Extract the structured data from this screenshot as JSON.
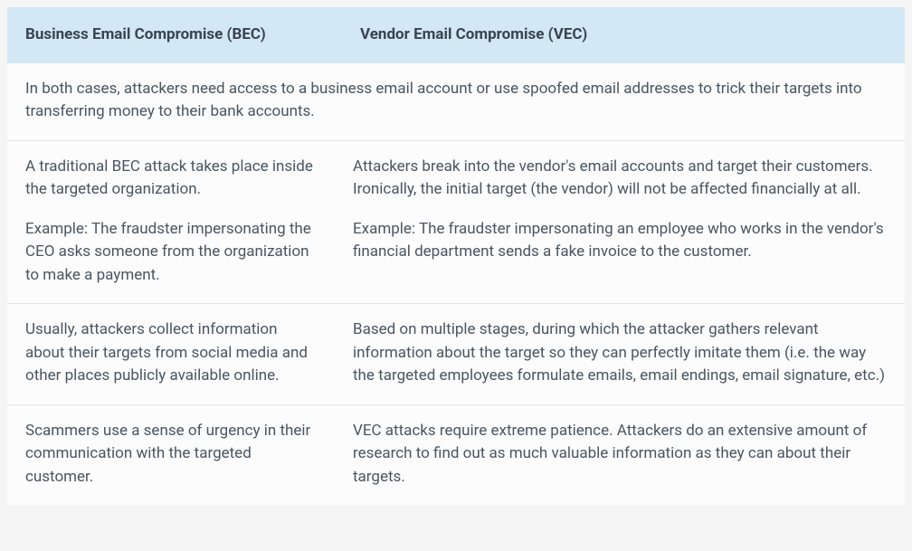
{
  "headers": {
    "bec": "Business Email Compromise (BEC)",
    "vec": "Vendor Email Compromise (VEC)"
  },
  "intro": "In both cases, attackers need access to a business email account or use spoofed email addresses to trick their targets into transferring money to their bank accounts.",
  "rows": [
    {
      "bec": {
        "p1": "A traditional BEC attack takes place inside the targeted organization.",
        "p2": "Example: The fraudster impersonating the CEO asks someone from the organization to make a payment."
      },
      "vec": {
        "p1": "Attackers break into the vendor's email accounts and target their customers. Ironically, the initial target (the vendor) will not be affected financially at all.",
        "p2": "Example: The fraudster impersonating an employee who works in the vendor's financial department sends a fake invoice to the customer."
      }
    },
    {
      "bec": {
        "p1": "Usually, attackers collect information about their targets from social media and other places publicly available online."
      },
      "vec": {
        "p1": "Based on multiple stages, during which the attacker gathers relevant information about the target so they can perfectly imitate them (i.e. the way the targeted employees formulate emails, email endings, email signature, etc.)"
      }
    },
    {
      "bec": {
        "p1": "Scammers use a sense of urgency in their communication with the targeted customer."
      },
      "vec": {
        "p1": "VEC attacks require extreme patience. Attackers do an extensive amount of research to find out as much valuable information as they can about their targets."
      }
    }
  ]
}
